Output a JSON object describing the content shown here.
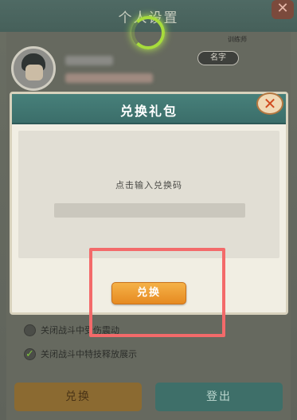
{
  "settings_panel": {
    "title": "个人设置",
    "rank_label": "训练师",
    "rename_label": "名字",
    "options": [
      {
        "label": "关闭战斗中受伤震动",
        "checked": false
      },
      {
        "label": "关闭战斗中特技释放展示",
        "checked": true
      }
    ],
    "redeem_label": "兑换",
    "logout_label": "登出"
  },
  "redeem_modal": {
    "title": "兑换礼包",
    "prompt": "点击输入兑换码",
    "code_value": "",
    "redeem_label": "兑换"
  },
  "colors": {
    "header_teal": "#3b6e6a",
    "button_orange": "#e68a21",
    "highlight_red": "#f36a6a"
  },
  "icons": {
    "close": "close-icon",
    "loading": "loading-spinner-icon",
    "check": "checkmark-icon"
  }
}
